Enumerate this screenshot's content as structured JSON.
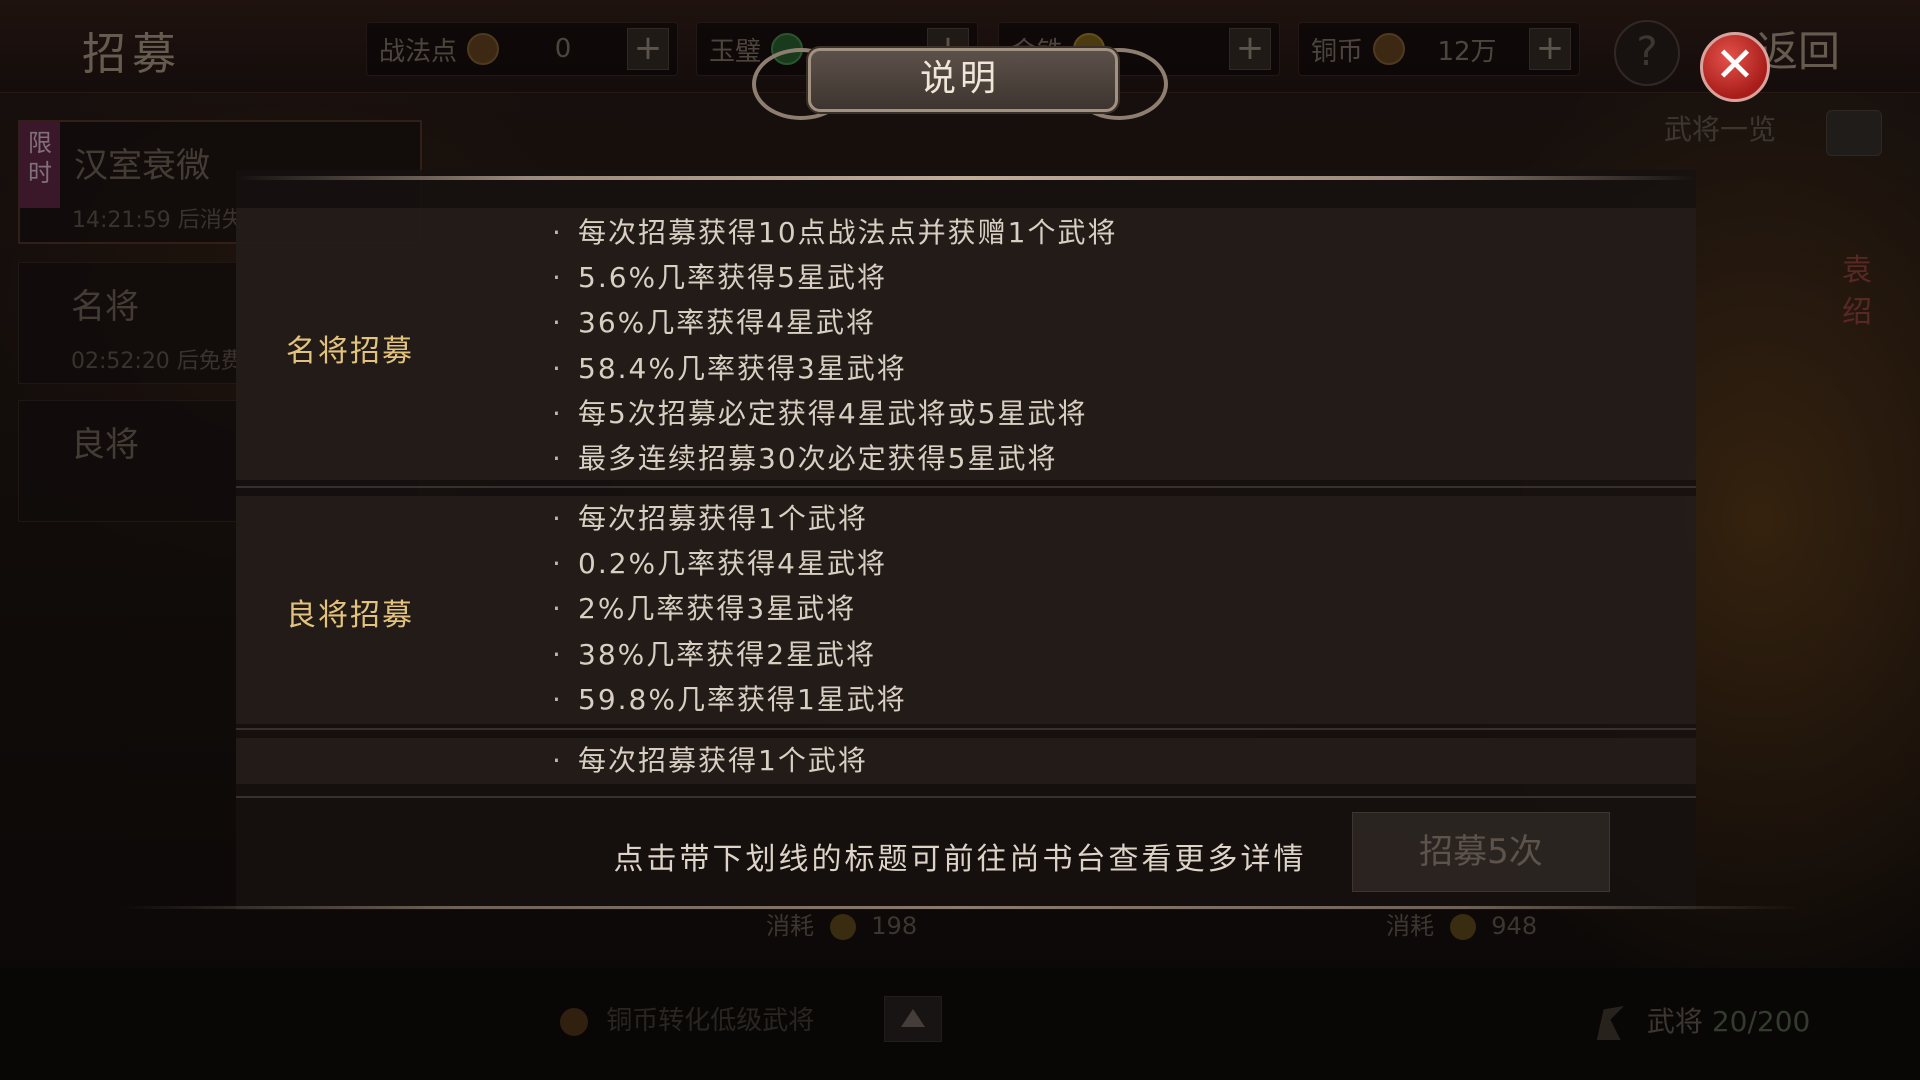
{
  "topbar": {
    "title": "招募",
    "resources": [
      {
        "label": "战法点",
        "value": "0"
      },
      {
        "label": "玉璧",
        "value": ""
      },
      {
        "label": "金铢",
        "value": ""
      },
      {
        "label": "铜币",
        "value": "12万"
      }
    ],
    "back_label": "返回"
  },
  "generals_list_label": "武将一览",
  "side_name": "袁绍",
  "recruit_cards": [
    {
      "badge": "限时",
      "title": "汉室衰微",
      "subtitle": "14:21:59 后消失"
    },
    {
      "title": "名将",
      "subtitle": "02:52:20 后免费"
    },
    {
      "title": "良将"
    }
  ],
  "costs": [
    {
      "label": "消耗",
      "value": "198"
    },
    {
      "label": "消耗",
      "value": "948"
    }
  ],
  "bottom": {
    "convert_label": "铜币转化低级武将",
    "generals_label": "武将",
    "generals_count": "20/200"
  },
  "modal": {
    "title": "说明",
    "sections": [
      {
        "title": "名将招募",
        "items": [
          "每次招募获得10点战法点并获赠1个武将",
          "5.6%几率获得5星武将",
          "36%几率获得4星武将",
          "58.4%几率获得3星武将",
          "每5次招募必定获得4星武将或5星武将",
          "最多连续招募30次必定获得5星武将"
        ]
      },
      {
        "title": "良将招募",
        "items": [
          "每次招募获得1个武将",
          "0.2%几率获得4星武将",
          "2%几率获得3星武将",
          "38%几率获得2星武将",
          "59.8%几率获得1星武将"
        ]
      },
      {
        "title": "",
        "items": [
          "每次招募获得1个武将"
        ]
      }
    ],
    "footer_note": "点击带下划线的标题可前往尚书台查看更多详情",
    "recruit_button": "招募5次"
  }
}
